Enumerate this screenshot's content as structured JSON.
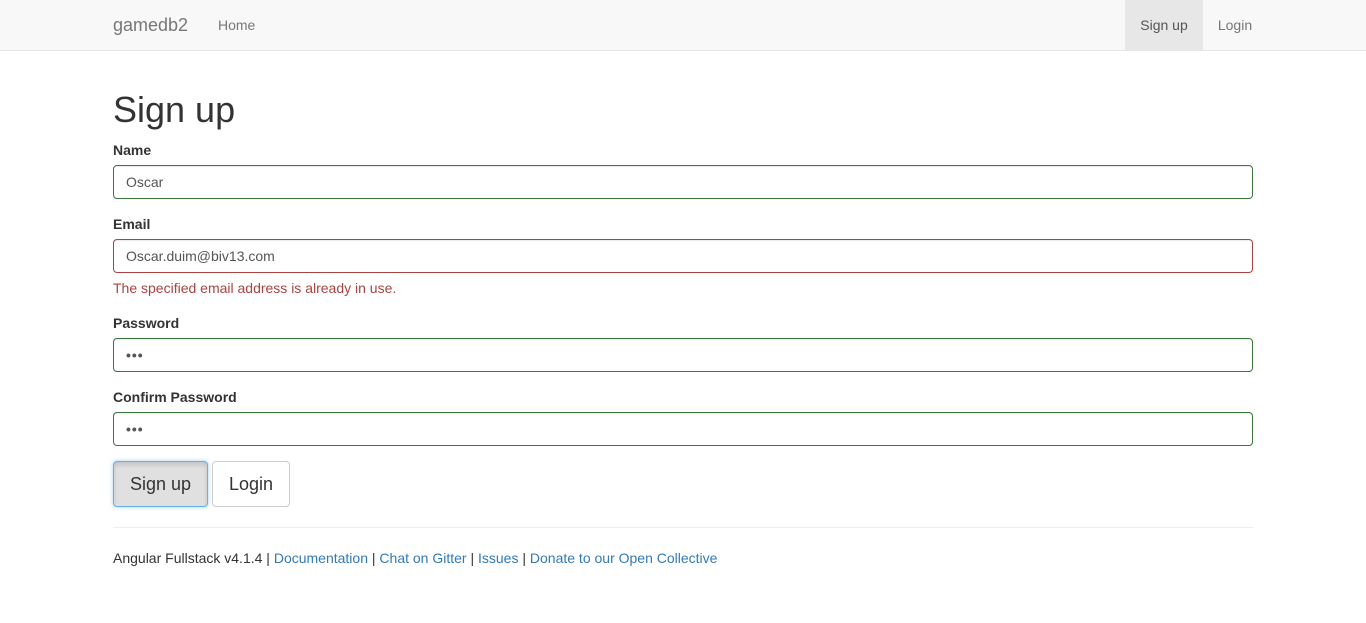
{
  "navbar": {
    "brand": "gamedb2",
    "home": "Home",
    "signup": "Sign up",
    "login": "Login"
  },
  "page": {
    "title": "Sign up"
  },
  "form": {
    "name_label": "Name",
    "name_value": "Oscar",
    "email_label": "Email",
    "email_value": "Oscar.duim@biv13.com",
    "email_error": "The specified email address is already in use.",
    "password_label": "Password",
    "password_value": "•••",
    "confirm_label": "Confirm Password",
    "confirm_value": "•••",
    "signup_button": "Sign up",
    "login_button": "Login"
  },
  "footer": {
    "version_text": "Angular Fullstack v4.1.4",
    "sep": "|",
    "documentation": "Documentation",
    "chat": "Chat on Gitter",
    "issues": "Issues",
    "donate": "Donate to our Open Collective"
  },
  "colors": {
    "valid_border": "#3c763d",
    "error": "#a94442",
    "link": "#337ab7",
    "navbar_bg": "#f8f8f8"
  }
}
